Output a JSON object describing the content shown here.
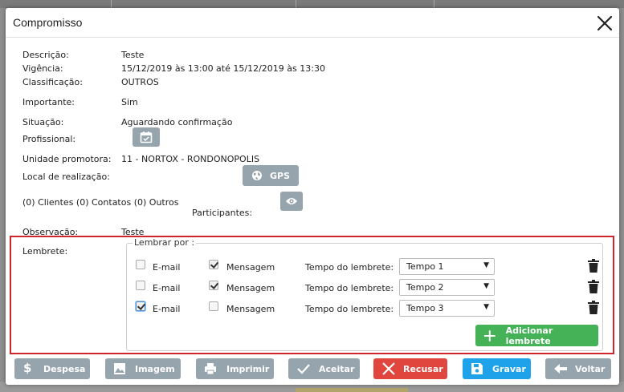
{
  "dialog": {
    "title": "Compromisso"
  },
  "details": {
    "descricao": {
      "label": "Descrição:",
      "value": "Teste"
    },
    "vigencia": {
      "label": "Vigência:",
      "value": "15/12/2019 às 13:00 até 15/12/2019 às 13:30"
    },
    "classificacao": {
      "label": "Classificação:",
      "value": "OUTROS"
    },
    "importante": {
      "label": "Importante:",
      "value": "Sim"
    },
    "situacao": {
      "label": "Situação:",
      "value": "Aguardando confirmação"
    },
    "profissional": {
      "label": "Profissional:"
    },
    "unidade": {
      "label": "Unidade promotora:",
      "value": "11 - NORTOX - RONDONOPOLIS"
    },
    "local": {
      "label": "Local de realização:",
      "gps_label": "GPS"
    },
    "participantes": {
      "counts": "(0) Clientes (0) Contatos (0) Outros",
      "label": "Participantes:"
    },
    "observacao": {
      "label": "Observação:",
      "value": "Teste"
    }
  },
  "reminders": {
    "section_label": "Lembrete:",
    "legend": "Lembrar por :",
    "email_label": "E-mail",
    "message_label": "Mensagem",
    "time_label": "Tempo do lembrete:",
    "rows": [
      {
        "email": false,
        "message": true,
        "time": "Tempo 1"
      },
      {
        "email": false,
        "message": true,
        "time": "Tempo 2"
      },
      {
        "email": true,
        "message": false,
        "time": "Tempo 3"
      }
    ],
    "add_label": "Adicionar lembrete"
  },
  "footer": {
    "despesa": "Despesa",
    "imagem": "Imagem",
    "imprimir": "Imprimir",
    "aceitar": "Aceitar",
    "recusar": "Recusar",
    "gravar": "Gravar",
    "voltar": "Voltar"
  },
  "colors": {
    "button_gray": "#96a4ad",
    "accept_green": "#45b258",
    "refuse_red": "#e0463e",
    "save_blue": "#1ea3ea",
    "highlight_red": "#d0262b"
  }
}
